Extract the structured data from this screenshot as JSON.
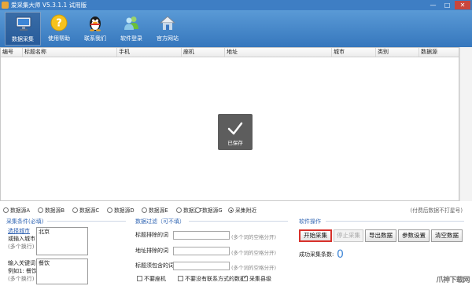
{
  "window": {
    "title": "爱采集大师 V5.3.1.1 试用版",
    "minimize_glyph": "—",
    "maximize_glyph": "□",
    "close_glyph": "✕"
  },
  "toolbar": {
    "items": [
      {
        "label": "数据采集",
        "icon": "monitor-icon",
        "active": true
      },
      {
        "label": "使用帮助",
        "icon": "question-icon"
      },
      {
        "label": "联系我们",
        "icon": "qq-penguin-icon"
      },
      {
        "label": "软件登录",
        "icon": "users-icon"
      },
      {
        "label": "官方网站",
        "icon": "home-icon"
      }
    ]
  },
  "table": {
    "columns": [
      "编号",
      "标题名称",
      "手机",
      "座机",
      "地址",
      "城市",
      "类别",
      "数据源"
    ],
    "rows": []
  },
  "toast": {
    "label": "已保存"
  },
  "sources": {
    "options": [
      "数据源A",
      "数据源B",
      "数据源C",
      "数据源D",
      "数据源E",
      "数据源F",
      "数据源G",
      "采集附近"
    ],
    "selected_index": 7,
    "hint": "(付费后数据不打星号)"
  },
  "conditions": {
    "title": "采集条件(必填)",
    "city_label": "选择城市",
    "city_sub": "或输入城市",
    "city_note": "(多个换行)",
    "city_value": "北京",
    "keyword_label": "输入关键词",
    "keyword_example": "例如1: 餐饮",
    "keyword_note": "(多个换行)",
    "keyword_value": "餐饮"
  },
  "filter": {
    "title": "数据过滤（可不填）",
    "rows": [
      {
        "label": "标题排除的词",
        "hint": "(多个词的空格分开)",
        "value": ""
      },
      {
        "label": "地址排除的词",
        "hint": "(多个词的空格分开)",
        "value": ""
      },
      {
        "label": "标题须包含的词",
        "hint": "(多个词的空格分开)",
        "value": ""
      }
    ],
    "checkboxes": [
      {
        "label": "不要座机",
        "checked": false
      },
      {
        "label": "不要没有联系方式的数据",
        "checked": false
      },
      {
        "label": "采集县级",
        "checked": true
      }
    ]
  },
  "actions": {
    "title": "软件操作",
    "start": "开始采集",
    "stop": "停止采集",
    "export": "导出数据",
    "settings": "参数设置",
    "clear": "清空数据",
    "success_label": "成功采集条数:",
    "success_count": "0"
  },
  "watermark": "爪神下载网"
}
